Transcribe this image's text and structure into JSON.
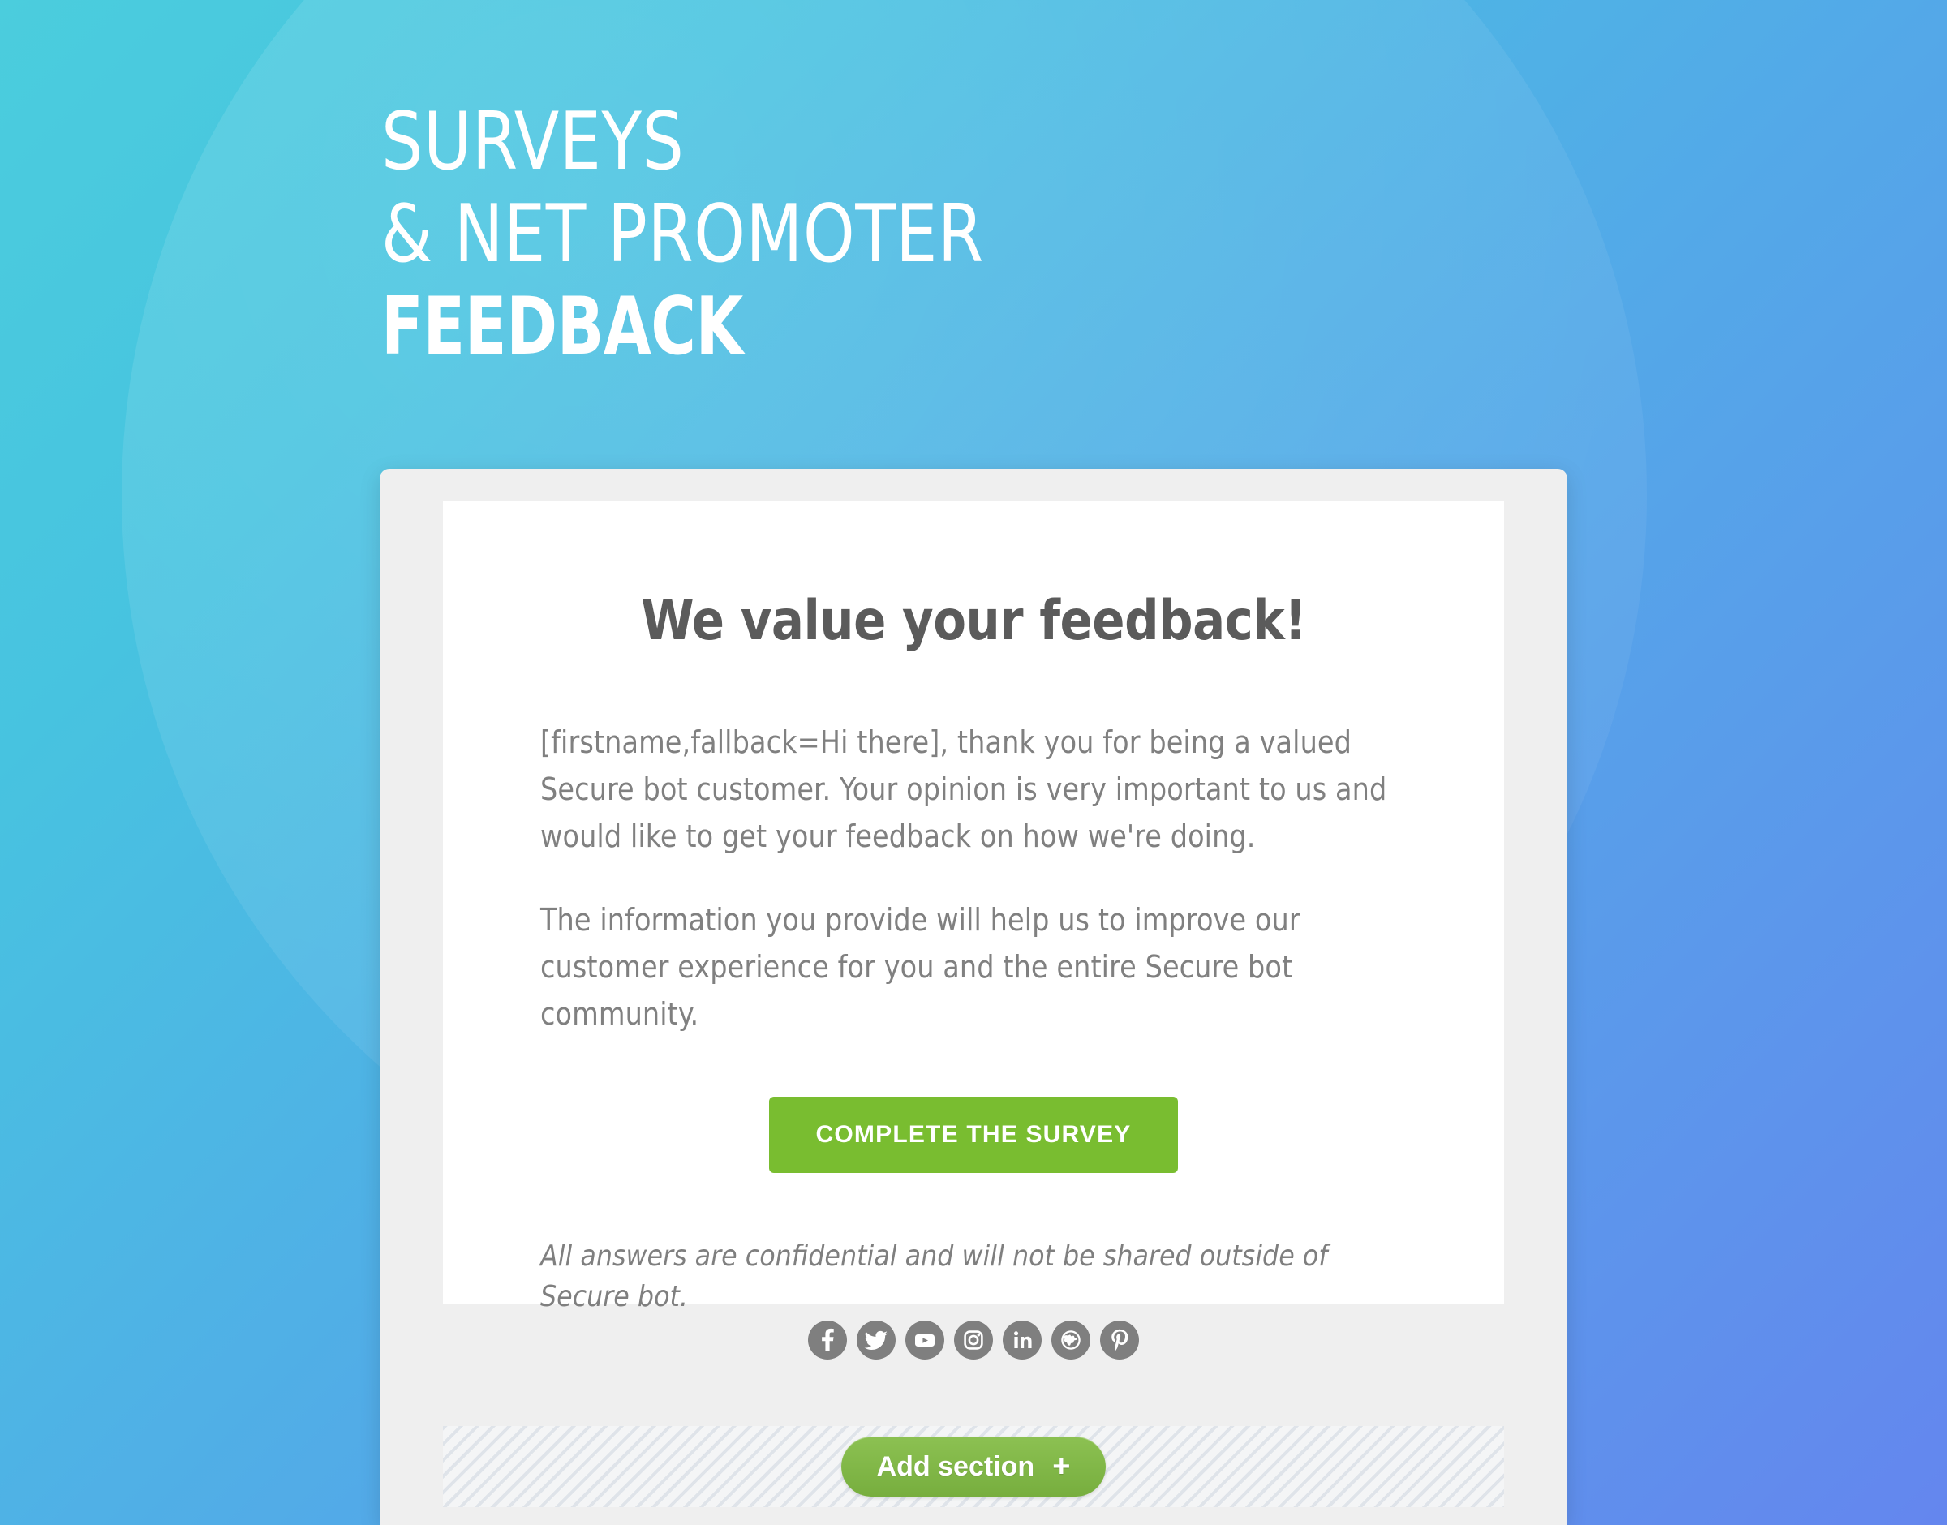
{
  "theme": {
    "gradient_start": "#4bcddd",
    "gradient_end": "#6486ee",
    "panel_bg": "#efefef",
    "card_bg": "#ffffff",
    "cta_green": "#79bd30",
    "add_section_green": "#8cc152",
    "text_gray": "#808080",
    "heading_gray": "#5b5b5b",
    "social_gray": "#7f7f7f"
  },
  "hero": {
    "line1": "SURVEYS",
    "line2": "& NET PROMOTER",
    "line3": "FEEDBACK"
  },
  "card": {
    "title": "We value your feedback!",
    "paragraphs": [
      "[firstname,fallback=Hi there], thank you for being a valued Secure bot customer. Your opinion is very important to us and would like to get your feedback on how we're doing.",
      "The information you provide will help us to improve our customer experience for you and the entire Secure bot community."
    ],
    "cta_label": "COMPLETE THE SURVEY",
    "disclaimer": "All answers are confidential and will not be shared outside of Secure bot."
  },
  "social": {
    "items": [
      {
        "name": "facebook-icon",
        "label": "Facebook"
      },
      {
        "name": "twitter-icon",
        "label": "Twitter"
      },
      {
        "name": "youtube-icon",
        "label": "YouTube"
      },
      {
        "name": "instagram-icon",
        "label": "Instagram"
      },
      {
        "name": "linkedin-icon",
        "label": "LinkedIn"
      },
      {
        "name": "website-globe-icon",
        "label": "Website"
      },
      {
        "name": "pinterest-icon",
        "label": "Pinterest"
      }
    ]
  },
  "add_section": {
    "label": "Add section",
    "plus": "+"
  }
}
